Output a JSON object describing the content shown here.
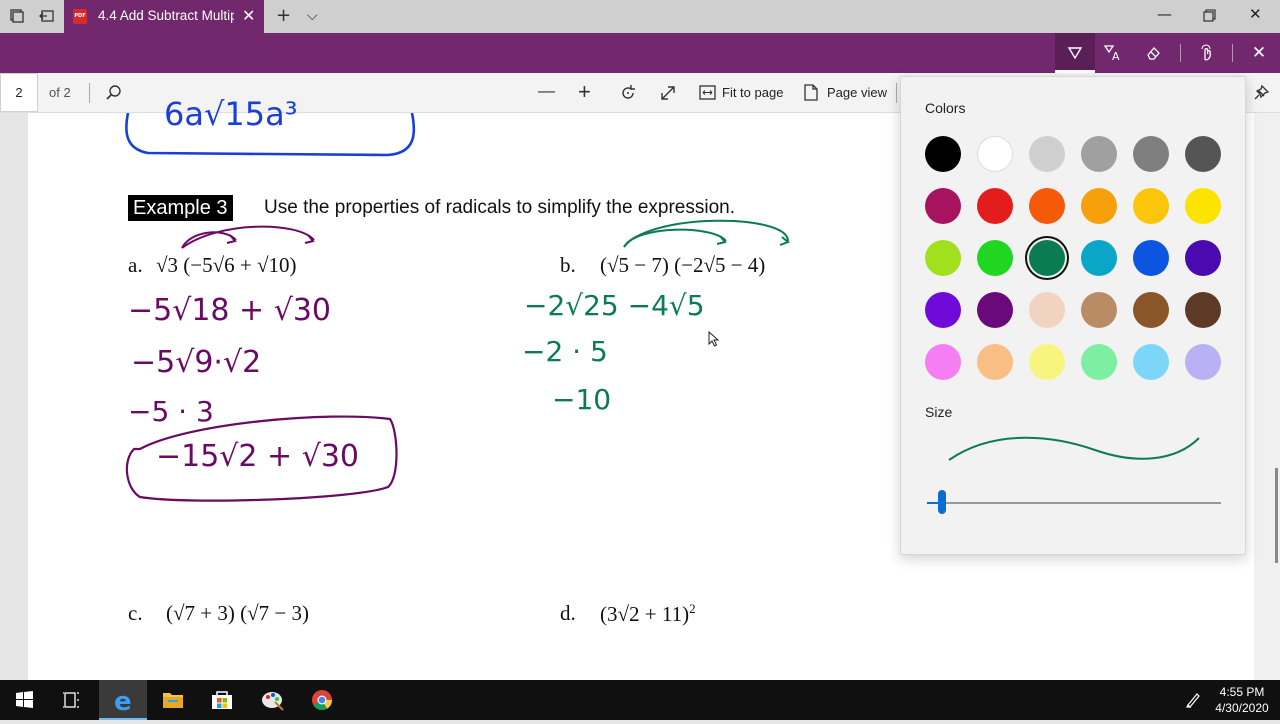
{
  "browser": {
    "tab_title": "4.4 Add Subtract Multip",
    "pdf_badge": "PDF"
  },
  "pdf_toolbar": {
    "page_number": "2",
    "page_count": "of 2",
    "fit_to_page": "Fit to page",
    "page_view": "Page view"
  },
  "document": {
    "example_label": "Example 3",
    "instruction": "Use the properties of radicals to simplify the expression.",
    "problems": {
      "a": "a.",
      "a_expr": "√3 (−5√6 + √10)",
      "b": "b.",
      "b_expr": "(√5 − 7) (−2√5 − 4)",
      "c": "c.",
      "c_expr": "(√7 + 3) (√7 − 3)",
      "d": "d.",
      "d_expr": "(3√2 + 11)",
      "d_exp": "2"
    },
    "ink_purple": {
      "top_partial": "6a√15a³",
      "line1": "−5√18 + √30",
      "line2": "−5√9·√2",
      "line3": "−5 · 3",
      "boxed": "−15√2 + √30"
    },
    "ink_green": {
      "line1": "−2√25 −4√5",
      "line2": "−2 · 5",
      "line3": "−10"
    }
  },
  "ink_panel": {
    "colors_label": "Colors",
    "size_label": "Size",
    "selected_color": "#0b7c52",
    "size_value": 0.05,
    "swatches": [
      [
        "#000000",
        "#ffffff",
        "#cfcfcf",
        "#a0a0a0",
        "#7f7f7f",
        "#555555"
      ],
      [
        "#a8135f",
        "#e31c1c",
        "#f55a0a",
        "#f8a00b",
        "#fbc60a",
        "#fce300"
      ],
      [
        "#a0e01c",
        "#20d620",
        "#0b7c52",
        "#0aa6c7",
        "#0b55e0",
        "#4b0ab0"
      ],
      [
        "#6f0ad8",
        "#6a0a7a",
        "#f2d2c0",
        "#b98c65",
        "#8a5528",
        "#5c3a25"
      ],
      [
        "#f57ef5",
        "#f9be83",
        "#f8f57e",
        "#7cf0a0",
        "#7cd6f8",
        "#b8b2f5"
      ]
    ]
  },
  "taskbar": {
    "time": "4:55 PM",
    "date": "4/30/2020"
  }
}
